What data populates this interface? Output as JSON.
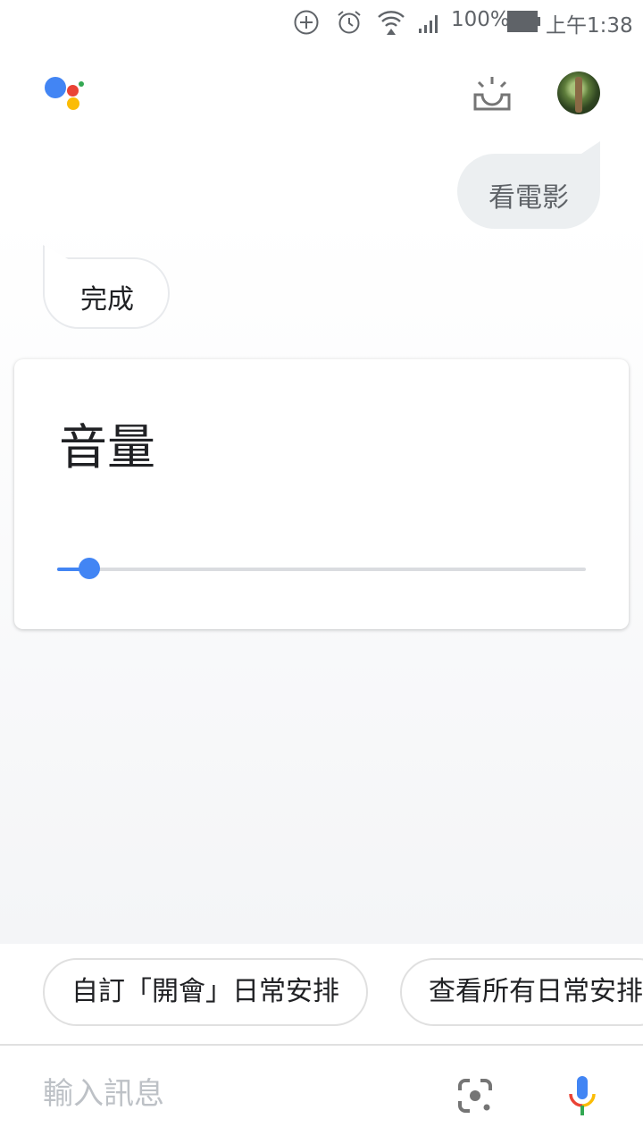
{
  "status_bar": {
    "battery": "100%",
    "time": "上午1:38",
    "icons": [
      "add-circle-icon",
      "alarm-icon",
      "wifi-icon",
      "signal-icon",
      "battery-icon"
    ]
  },
  "header": {
    "logo_icon": "google-assistant-logo",
    "snapshot_icon": "snapshot-icon",
    "avatar_icon": "user-avatar"
  },
  "conversation": {
    "user_message": "看電影",
    "assistant_reply": "完成"
  },
  "volume_card": {
    "title": "音量",
    "level": 0.06,
    "accent": "#4285f4"
  },
  "suggestions": [
    {
      "label": "自訂「開會」日常安排"
    },
    {
      "label": "查看所有日常安排"
    }
  ],
  "input": {
    "placeholder": "輸入訊息",
    "value": "",
    "lens_icon": "google-lens-icon",
    "mic_icon": "microphone-icon"
  },
  "colors": {
    "google_blue": "#4285f4",
    "google_red": "#ea4335",
    "google_yellow": "#fbbc05",
    "google_green": "#34a853"
  }
}
